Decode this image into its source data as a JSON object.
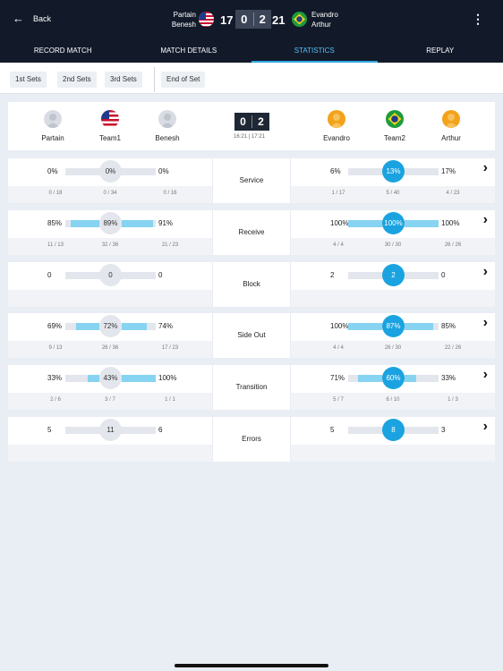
{
  "header": {
    "back_label": "Back",
    "team1_players": [
      "Partain",
      "Benesh"
    ],
    "team2_players": [
      "Evandro",
      "Arthur"
    ],
    "score_team1": "17",
    "score_team2": "21",
    "sets_team1": "0",
    "sets_team2": "2",
    "more_icon": "⋮"
  },
  "tabs": [
    {
      "label": "RECORD MATCH"
    },
    {
      "label": "MATCH DETAILS"
    },
    {
      "label": "STATISTICS",
      "active": true
    },
    {
      "label": "REPLAY"
    }
  ],
  "set_filters": [
    "1st Sets",
    "2nd Sets",
    "3rd Sets",
    "End of Set"
  ],
  "summary": {
    "team1": {
      "players": [
        "Partain",
        "Team1",
        "Benesh"
      ]
    },
    "team2": {
      "players": [
        "Evandro",
        "Team2",
        "Arthur"
      ]
    },
    "sets": [
      "0",
      "2"
    ],
    "times": "16:21 | 17:21"
  },
  "colors": {
    "header_bg": "#121a2a",
    "accent": "#1aa3e0",
    "bar": "#87d3f2"
  },
  "stats": [
    {
      "label": "Service",
      "t1": {
        "p1": "0%",
        "team": "0%",
        "p2": "0%",
        "p1_frac": "0 / 18",
        "team_frac": "0 / 34",
        "p2_frac": "0 / 16",
        "p1_level": 0,
        "p2_level": 0
      },
      "t2": {
        "p1": "6%",
        "team": "13%",
        "p2": "17%",
        "p1_frac": "1 / 17",
        "team_frac": "5 / 40",
        "p2_frac": "4 / 23",
        "p1_level": 0,
        "p2_level": 0
      }
    },
    {
      "label": "Receive",
      "t1": {
        "p1": "85%",
        "team": "89%",
        "p2": "91%",
        "p1_frac": "11 / 13",
        "team_frac": "32 / 36",
        "p2_frac": "21 / 23",
        "p1_level": 0.85,
        "p2_level": 0.91
      },
      "t2": {
        "p1": "100%",
        "team": "100%",
        "p2": "100%",
        "p1_frac": "4 / 4",
        "team_frac": "30 / 30",
        "p2_frac": "26 / 26",
        "p1_level": 1,
        "p2_level": 1
      }
    },
    {
      "label": "Block",
      "t1": {
        "p1": "0",
        "team": "0",
        "p2": "0",
        "p1_frac": "",
        "team_frac": "",
        "p2_frac": "",
        "p1_level": 0,
        "p2_level": 0
      },
      "t2": {
        "p1": "2",
        "team": "2",
        "p2": "0",
        "p1_frac": "",
        "team_frac": "",
        "p2_frac": "",
        "p1_level": 0,
        "p2_level": 0
      }
    },
    {
      "label": "Side Out",
      "t1": {
        "p1": "69%",
        "team": "72%",
        "p2": "74%",
        "p1_frac": "9 / 13",
        "team_frac": "26 / 36",
        "p2_frac": "17 / 23",
        "p1_level": 0.69,
        "p2_level": 0.74
      },
      "t2": {
        "p1": "100%",
        "team": "87%",
        "p2": "85%",
        "p1_frac": "4 / 4",
        "team_frac": "26 / 30",
        "p2_frac": "22 / 26",
        "p1_level": 1,
        "p2_level": 0.85
      }
    },
    {
      "label": "Transition",
      "t1": {
        "p1": "33%",
        "team": "43%",
        "p2": "100%",
        "p1_frac": "2 / 6",
        "team_frac": "3 / 7",
        "p2_frac": "1 / 1",
        "p1_level": 0.33,
        "p2_level": 1
      },
      "t2": {
        "p1": "71%",
        "team": "60%",
        "p2": "33%",
        "p1_frac": "5 / 7",
        "team_frac": "6 / 10",
        "p2_frac": "1 / 3",
        "p1_level": 0.71,
        "p2_level": 0.33
      }
    },
    {
      "label": "Errors",
      "t1": {
        "p1": "5",
        "team": "11",
        "p2": "6",
        "p1_frac": "",
        "team_frac": "",
        "p2_frac": "",
        "p1_level": 0,
        "p2_level": 0
      },
      "t2": {
        "p1": "5",
        "team": "8",
        "p2": "3",
        "p1_frac": "",
        "team_frac": "",
        "p2_frac": "",
        "p1_level": 0,
        "p2_level": 0
      }
    }
  ]
}
